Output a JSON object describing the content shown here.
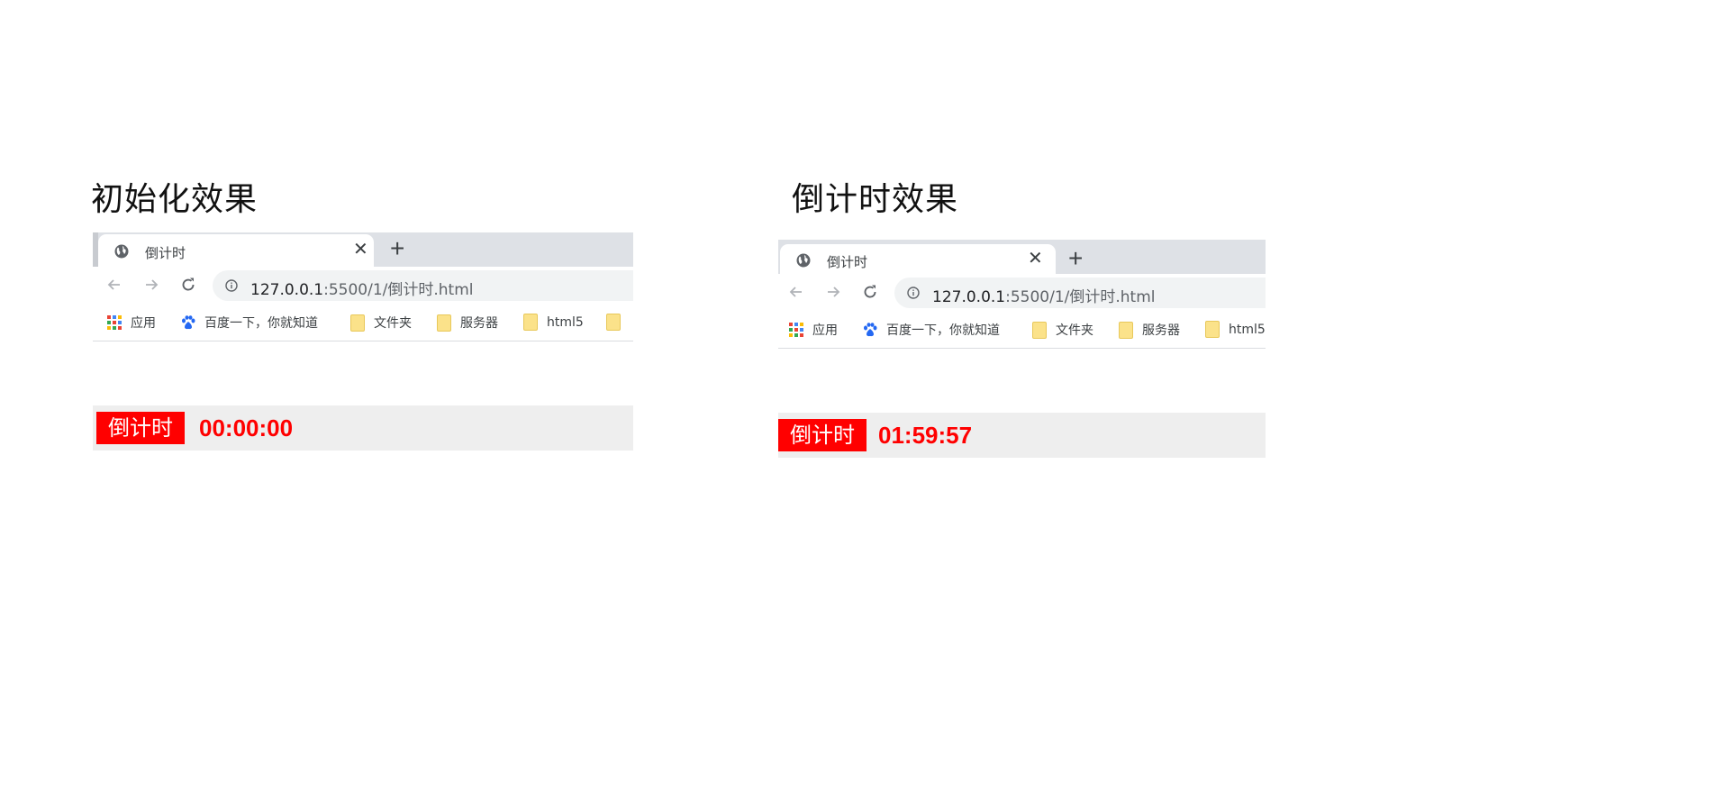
{
  "panels": [
    {
      "heading": "初始化效果",
      "tab_title": "倒计时",
      "url_host": "127.0.0.1",
      "url_rest": ":5500/1/倒计时.html",
      "bookmarks": {
        "apps": "应用",
        "baidu": "百度一下，你就知道",
        "folder1": "文件夹",
        "folder2": "服务器",
        "folder3": "html5"
      },
      "countdown_label": "倒计时",
      "countdown_time": "00:00:00"
    },
    {
      "heading": "倒计时效果",
      "tab_title": "倒计时",
      "url_host": "127.0.0.1",
      "url_rest": ":5500/1/倒计时.html",
      "bookmarks": {
        "apps": "应用",
        "baidu": "百度一下，你就知道",
        "folder1": "文件夹",
        "folder2": "服务器",
        "folder3": "html5"
      },
      "countdown_label": "倒计时",
      "countdown_time": "01:59:57"
    }
  ],
  "colors": {
    "countdown_red": "#ff0000",
    "countdown_bar_bg": "#eeeeee",
    "tabstrip_bg": "#dee1e6",
    "omnibox_bg": "#f1f3f4"
  },
  "icons": [
    "globe-icon",
    "close-icon",
    "plus-icon",
    "back-arrow-icon",
    "forward-arrow-icon",
    "reload-icon",
    "info-icon",
    "apps-grid-icon",
    "baidu-paw-icon",
    "folder-icon"
  ]
}
